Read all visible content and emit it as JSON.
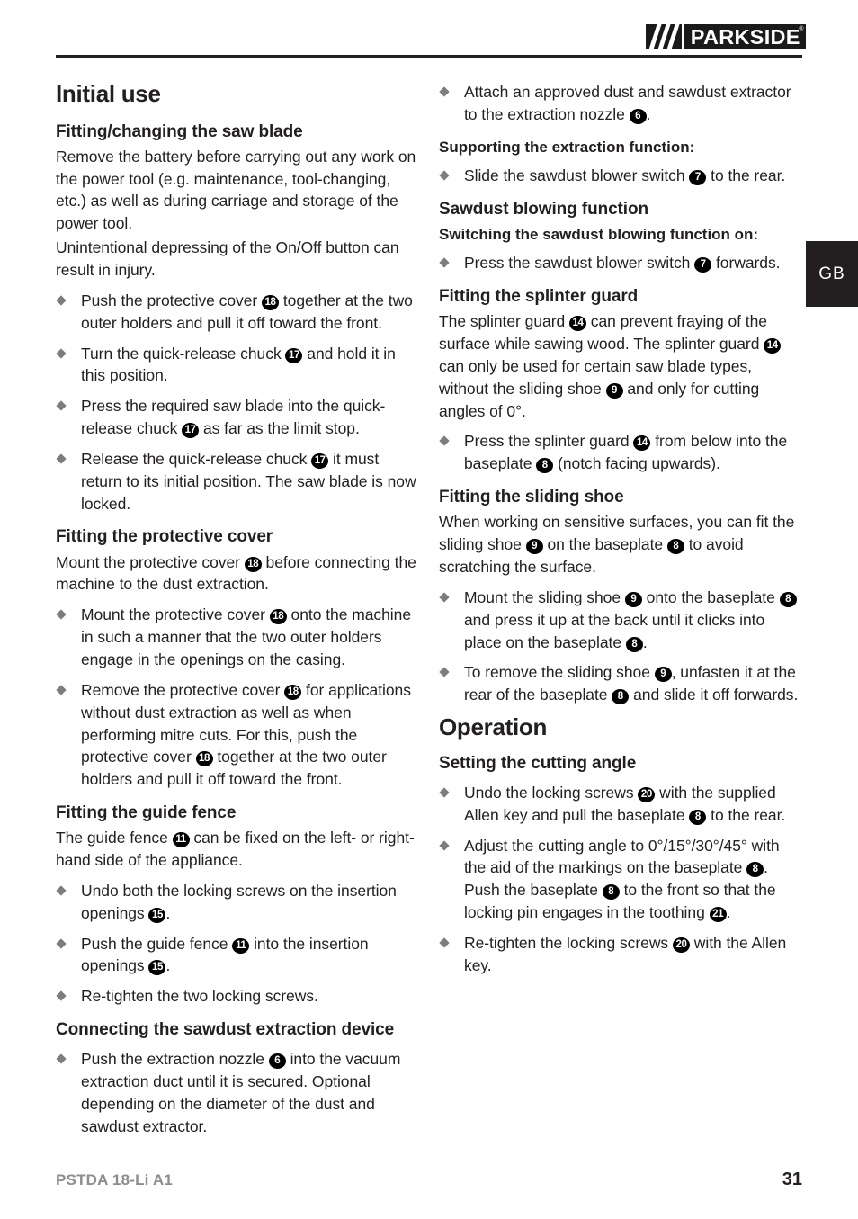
{
  "header": {
    "brand": "PARKSIDE",
    "registered_mark": "®"
  },
  "language_tab": "GB",
  "footer": {
    "model": "PSTDA 18-Li A1",
    "page_number": "31"
  },
  "left_column": {
    "h1": "Initial use",
    "s1": {
      "heading": "Fitting/changing the saw blade",
      "p1": "Remove the battery before carrying out any work on the power tool (e.g. maintenance, tool-changing, etc.) as well as during carriage and storage of the power tool.",
      "p2": "Unintentional depressing of the On/Off button can result in injury.",
      "b1_a": "Push the protective cover",
      "b1_n": "18",
      "b1_b": "together at the two outer holders and pull it off toward the front.",
      "b2_a": "Turn the quick-release chuck",
      "b2_n": "17",
      "b2_b": "and hold it in this position.",
      "b3_a": "Press the required saw blade into the quick-release chuck",
      "b3_n": "17",
      "b3_b": "as far as the limit stop.",
      "b4_a": "Release the quick-release chuck",
      "b4_n": "17",
      "b4_b": "it must return to its initial position. The saw blade is now locked."
    },
    "s2": {
      "heading": "Fitting the protective cover",
      "p1_a": "Mount the protective cover",
      "p1_n": "18",
      "p1_b": "before connecting the machine to the dust extraction.",
      "b1_a": "Mount the protective cover",
      "b1_n": "18",
      "b1_b": "onto the machine in such a manner that the two outer holders engage in the openings on the casing.",
      "b2_a": "Remove the protective cover",
      "b2_n1": "18",
      "b2_b": "for applications without dust extraction as well as when performing mitre cuts. For this, push the protective cover",
      "b2_n2": "18",
      "b2_c": "together at the two outer holders and pull it off toward the front."
    },
    "s3": {
      "heading": "Fitting the guide fence",
      "p1_a": "The guide fence",
      "p1_n": "11",
      "p1_b": "can be fixed on the left- or right-hand side of the appliance.",
      "b1_a": "Undo both the locking screws on the insertion openings",
      "b1_n": "15",
      "b1_b": ".",
      "b2_a": "Push the guide fence",
      "b2_n1": "11",
      "b2_b": "into the insertion openings",
      "b2_n2": "15",
      "b2_c": ".",
      "b3": "Re-tighten the two locking screws."
    },
    "s4": {
      "heading": "Connecting the sawdust extraction device",
      "b1_a": "Push the extraction nozzle",
      "b1_n": "6",
      "b1_b": "into the vacuum extraction duct until it is secured. Optional depending on the diameter of the dust and sawdust extractor."
    }
  },
  "right_column": {
    "s1": {
      "b1_a": "Attach an approved dust and sawdust extractor to the extraction nozzle",
      "b1_n": "6",
      "b1_b": "."
    },
    "s2": {
      "heading": "Supporting the extraction function:",
      "b1_a": "Slide the sawdust blower switch",
      "b1_n": "7",
      "b1_b": "to the rear."
    },
    "s3": {
      "heading": "Sawdust blowing function",
      "sub_heading": "Switching the sawdust blowing function on:",
      "b1_a": "Press the sawdust blower switch",
      "b1_n": "7",
      "b1_b": "forwards."
    },
    "s4": {
      "heading": "Fitting the splinter guard",
      "p1_a": "The splinter guard",
      "p1_n1": "14",
      "p1_b": "can prevent fraying of the surface while sawing wood. The splinter guard",
      "p1_n2": "14",
      "p1_c": "can only be used for certain saw blade types, without the sliding shoe",
      "p1_n3": "9",
      "p1_d": "and only for cutting angles of 0°.",
      "b1_a": "Press the splinter guard",
      "b1_n1": "14",
      "b1_b": "from below into the baseplate",
      "b1_n2": "8",
      "b1_c": "(notch facing upwards)."
    },
    "s5": {
      "heading": "Fitting the sliding shoe",
      "p1_a": "When working on sensitive surfaces, you can fit the sliding shoe",
      "p1_n1": "9",
      "p1_b": "on the baseplate",
      "p1_n2": "8",
      "p1_c": "to avoid scratching the surface.",
      "b1_a": "Mount the sliding shoe",
      "b1_n1": "9",
      "b1_b": "onto the baseplate",
      "b1_n2": "8",
      "b1_c": "and press it up at the back until it clicks into place on the baseplate",
      "b1_n3": "8",
      "b1_d": ".",
      "b2_a": "To remove the sliding shoe",
      "b2_n1": "9",
      "b2_b": ", unfasten it at the rear of the baseplate",
      "b2_n2": "8",
      "b2_c": "and slide it off forwards."
    },
    "h1": "Operation",
    "s6": {
      "heading": "Setting the cutting angle",
      "b1_a": "Undo the locking screws",
      "b1_n1": "20",
      "b1_b": "with the supplied Allen key and pull the baseplate",
      "b1_n2": "8",
      "b1_c": "to the rear.",
      "b2_a": "Adjust the cutting angle to 0°/15°/30°/45° with the aid of the markings on the baseplate",
      "b2_n1": "8",
      "b2_b": ". Push the baseplate",
      "b2_n2": "8",
      "b2_c": "to the front so that the locking pin engages in the toothing",
      "b2_n3": "21",
      "b2_d": ".",
      "b3_a": "Re-tighten the locking screws",
      "b3_n": "20",
      "b3_b": "with the Allen key."
    }
  }
}
